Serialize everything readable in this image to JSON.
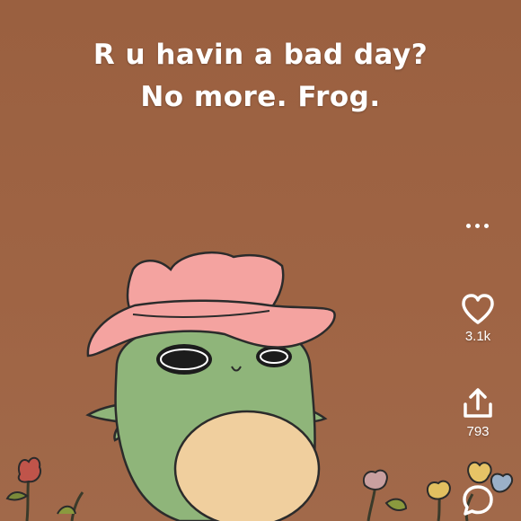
{
  "video": {
    "caption_line1": "R u havin a bad day?",
    "caption_line2": "No more. Frog.",
    "background_color": "#9e6343"
  },
  "actions": {
    "more_icon": "more-horizontal-icon",
    "like": {
      "icon": "heart-outline-icon",
      "count": "3.1k"
    },
    "share": {
      "icon": "share-icon",
      "count": "793"
    },
    "comment": {
      "icon": "comment-bubble-icon"
    }
  },
  "colors": {
    "frog": "#8fb57a",
    "frog_belly": "#f0cf9e",
    "hat": "#f4a3a0",
    "outline": "#2b2b2b",
    "text": "#ffffff"
  }
}
